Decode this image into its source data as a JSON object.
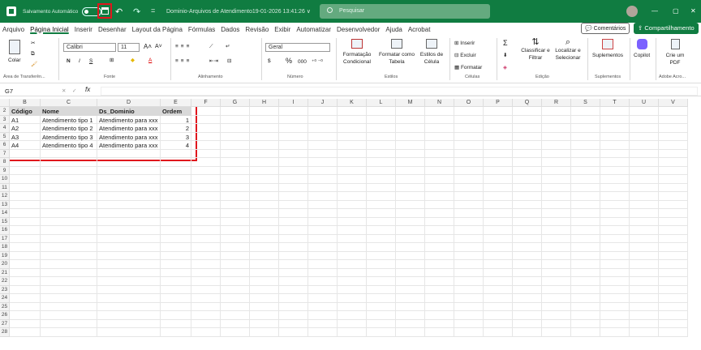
{
  "titlebar": {
    "autosave_label": "Salvamento Automático",
    "doc_title": "Dominio-Arquivos de Atendimento19-01-2026 13:41:26 ∨",
    "search_placeholder": "Pesquisar",
    "window_buttons": [
      "—",
      "▢",
      "✕"
    ]
  },
  "menu": {
    "tabs": [
      "Arquivo",
      "Página Inicial",
      "Inserir",
      "Desenhar",
      "Layout da Página",
      "Fórmulas",
      "Dados",
      "Revisão",
      "Exibir",
      "Automatizar",
      "Desenvolvedor",
      "Ajuda",
      "Acrobat"
    ],
    "active_index": 1,
    "comments_label": "Comentários",
    "share_label": "Compartilhamento"
  },
  "ribbon": {
    "paste_label": "Colar",
    "font_name": "Calibri",
    "font_size": "11",
    "number_format": "Geral",
    "bold": "N",
    "italic": "I",
    "underline": "S",
    "insert": "Inserir",
    "delete": "Excluir",
    "format": "Formatar",
    "cond_format": "Formatação Condicional",
    "format_table": "Formatar como Tabela",
    "cell_styles": "Estilos de Célula",
    "sort_filter": "Classificar e Filtrar",
    "find_select": "Localizar e Selecionar",
    "addins": "Suplementos",
    "copilot": "Copilot",
    "create_pdf": "Crie um PDF",
    "groups": {
      "clipboard": "Área de Transferên...",
      "font": "Fonte",
      "alignment": "Alinhamento",
      "number": "Número",
      "styles": "Estilos",
      "cells": "Células",
      "editing": "Edição",
      "addins": "Suplementos",
      "acrobat": "Adobe Acro..."
    }
  },
  "formula_bar": {
    "name_box": "G7",
    "fx": "fx",
    "value": ""
  },
  "sheet": {
    "columns": [
      "B",
      "C",
      "D",
      "E",
      "F",
      "G",
      "H",
      "I",
      "J",
      "K",
      "L",
      "M",
      "N",
      "O",
      "P",
      "Q",
      "R",
      "S",
      "T",
      "U",
      "V"
    ],
    "rows": [
      "2",
      "3",
      "4",
      "5",
      "6",
      "7",
      "8",
      "9",
      "10",
      "11",
      "12",
      "13",
      "14",
      "15",
      "16",
      "17",
      "18",
      "19",
      "20",
      "21",
      "22",
      "23",
      "24",
      "25",
      "26",
      "27",
      "28"
    ],
    "table_headers": [
      "Código",
      "Nome",
      "Ds_Dominio",
      "Ordem"
    ],
    "table_rows": [
      [
        "A1",
        "Atendimento tipo 1",
        "Atendimento para xxx",
        "1"
      ],
      [
        "A2",
        "Atendimento tipo 2",
        "Atendimento para xxx",
        "2"
      ],
      [
        "A3",
        "Atendimento tipo 3",
        "Atendimento para xxx",
        "3"
      ],
      [
        "A4",
        "Atendimento tipo 4",
        "Atendimento para xxx",
        "4"
      ]
    ]
  },
  "colors": {
    "brand": "#107c41",
    "highlight": "#e0161d",
    "header_fill": "#d9d9d9"
  }
}
